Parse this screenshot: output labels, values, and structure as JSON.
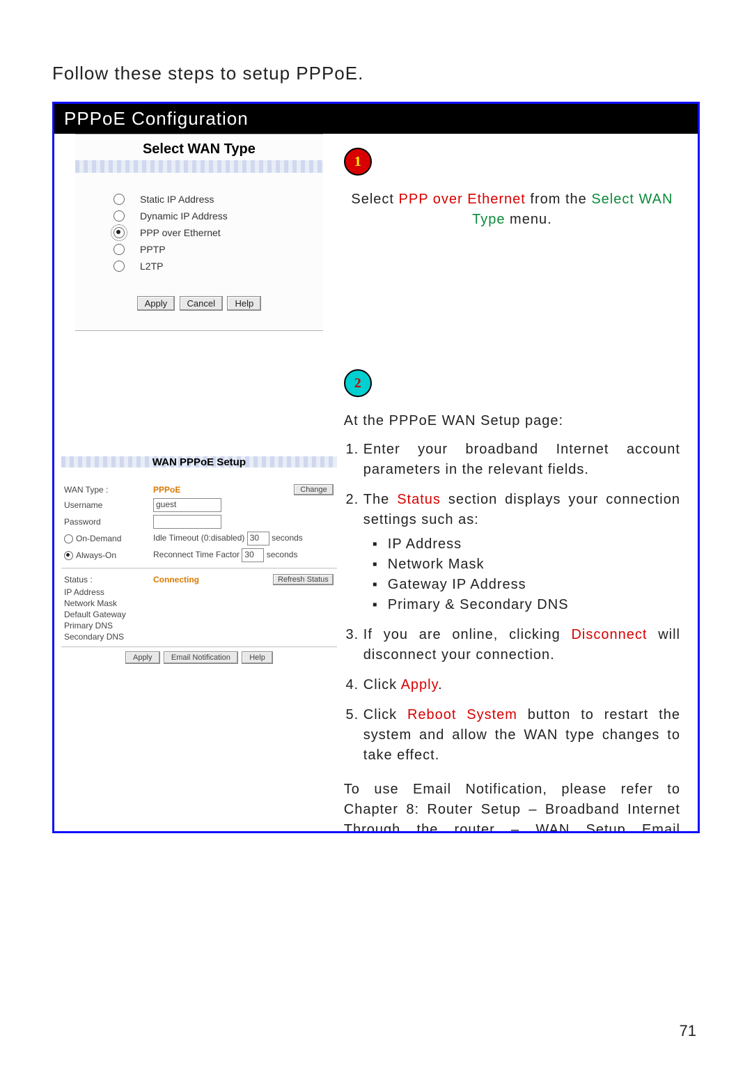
{
  "intro": "Follow these steps to setup PPPoE.",
  "panel_title": "PPPoE Configuration",
  "page_number": "71",
  "step1": {
    "number": "1",
    "line_pre": "Select ",
    "hl1": "PPP over Ethernet",
    "mid": " from the ",
    "hl2": "Select WAN Type",
    "post": " menu."
  },
  "card1": {
    "title": "Select WAN Type",
    "options": [
      {
        "label": "Static IP Address",
        "selected": false
      },
      {
        "label": "Dynamic IP Address",
        "selected": false
      },
      {
        "label": "PPP over Ethernet",
        "selected": true
      },
      {
        "label": "PPTP",
        "selected": false
      },
      {
        "label": "L2TP",
        "selected": false
      }
    ],
    "buttons": {
      "apply": "Apply",
      "cancel": "Cancel",
      "help": "Help"
    }
  },
  "step2": {
    "number": "2",
    "lead": "At the PPPoE WAN Setup page:",
    "li1": "Enter your broadband Internet account parameters in the relevant fields.",
    "li2_pre": "The ",
    "li2_hl": "Status",
    "li2_post": " section displays your connection settings such as:",
    "sub": [
      "IP Address",
      "Network Mask",
      "Gateway IP Address",
      "Primary & Secondary DNS"
    ],
    "li3_pre": "If you are online, clicking ",
    "li3_hl": "Disconnect",
    "li3_post": " will disconnect your connection.",
    "li4_pre": "Click ",
    "li4_hl": "Apply",
    "li4_post": ".",
    "li5_pre": "Click ",
    "li5_hl": "Reboot System",
    "li5_post": " button to restart the system and allow the WAN type changes to take effect.",
    "note": "To use Email Notification, please refer to Chapter 8: Router Setup – Broadband Internet Through the router – WAN Setup Email Notification"
  },
  "card2": {
    "title": "WAN PPPoE Setup",
    "wan_type_label": "WAN Type :",
    "wan_type_value": "PPPoE",
    "change": "Change",
    "username_label": "Username",
    "username_value": "guest",
    "password_label": "Password",
    "on_demand": "On-Demand",
    "always_on": "Always-On",
    "idle_label": "Idle Timeout (0:disabled)",
    "idle_value": "30",
    "reconnect_label": "Reconnect Time Factor",
    "reconnect_value": "30",
    "seconds": "seconds",
    "status_label": "Status :",
    "status_value": "Connecting",
    "refresh": "Refresh Status",
    "rows": [
      "IP Address",
      "Network Mask",
      "Default Gateway",
      "Primary DNS",
      "Secondary DNS"
    ],
    "bottom_buttons": {
      "apply": "Apply",
      "email": "Email Notification",
      "help": "Help"
    }
  }
}
